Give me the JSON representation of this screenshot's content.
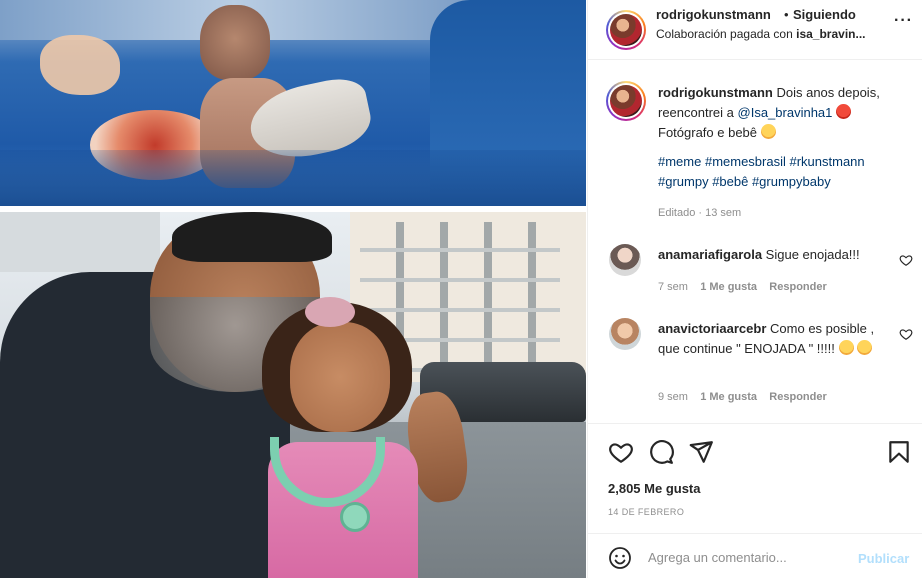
{
  "post": {
    "author": "rodrigokunstmann",
    "separator": "•",
    "follow_status": "Siguiendo",
    "collab_prefix": "Colaboración pagada con",
    "collab_partner": "isa_bravin..."
  },
  "caption": {
    "author": "rodrigokunstmann",
    "text_1": "Dois anos depois, reencontrei a",
    "mention": "@Isa_bravinha1",
    "text_2": "Fotógrafo e bebê",
    "hashtags": "#meme #memesbrasil #rkunstmann #grumpy #bebê #grumpybaby",
    "meta": "Editado · 13 sem"
  },
  "comments": [
    {
      "user": "anamariafigarola",
      "text": "Sigue enojada!!!",
      "time": "7 sem",
      "likes": "1 Me gusta",
      "reply": "Responder"
    },
    {
      "user": "anavictoriaarcebr",
      "text": "Como es posible , que continue \" ENOJADA \" !!!!!",
      "time": "9 sem",
      "likes": "1 Me gusta",
      "reply": "Responder"
    }
  ],
  "stats": {
    "likes": "2,805 Me gusta",
    "date": "14 DE FEBRERO"
  },
  "composer": {
    "placeholder": "Agrega un comentario...",
    "publish_label": "Publicar"
  },
  "colors": {
    "link": "#00376b",
    "publish_disabled": "#b2dffc",
    "muted": "#8e8e8e",
    "border": "#efefef"
  },
  "icons": {
    "header": [
      "more-icon"
    ],
    "actions": [
      "heart-icon",
      "comment-icon",
      "share-icon",
      "bookmark-icon"
    ],
    "composer": [
      "emoji-icon"
    ]
  }
}
